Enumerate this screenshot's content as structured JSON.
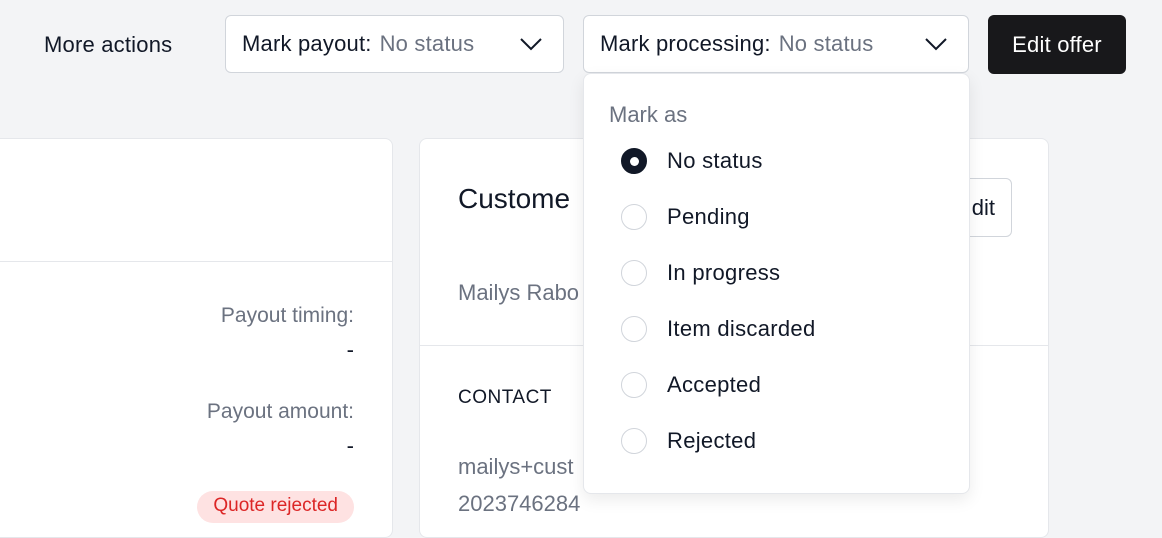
{
  "toolbar": {
    "more_actions": "More actions",
    "payout_select": {
      "label": "Mark payout:",
      "value": "No status"
    },
    "processing_select": {
      "label": "Mark processing:",
      "value": "No status"
    },
    "edit_offer": "Edit offer"
  },
  "left_card": {
    "payout_timing_label": "Payout timing:",
    "payout_timing_value": "-",
    "payout_amount_label": "Payout amount:",
    "payout_amount_value": "-",
    "status_badge": "Quote rejected"
  },
  "customer_card": {
    "title": "Custome",
    "edit_label": "dit",
    "name": "Mailys Rabo",
    "contact_heading": "CONTACT",
    "email": "mailys+cust",
    "phone": "2023746284"
  },
  "processing_dropdown": {
    "heading": "Mark as",
    "options": [
      {
        "label": "No status",
        "checked": true
      },
      {
        "label": "Pending",
        "checked": false
      },
      {
        "label": "In progress",
        "checked": false
      },
      {
        "label": "Item discarded",
        "checked": false
      },
      {
        "label": "Accepted",
        "checked": false
      },
      {
        "label": "Rejected",
        "checked": false
      }
    ]
  },
  "colors": {
    "background": "#f3f4f6",
    "primary_button": "#18181b",
    "badge_bg": "#fee2e2",
    "badge_text": "#dc2626"
  }
}
